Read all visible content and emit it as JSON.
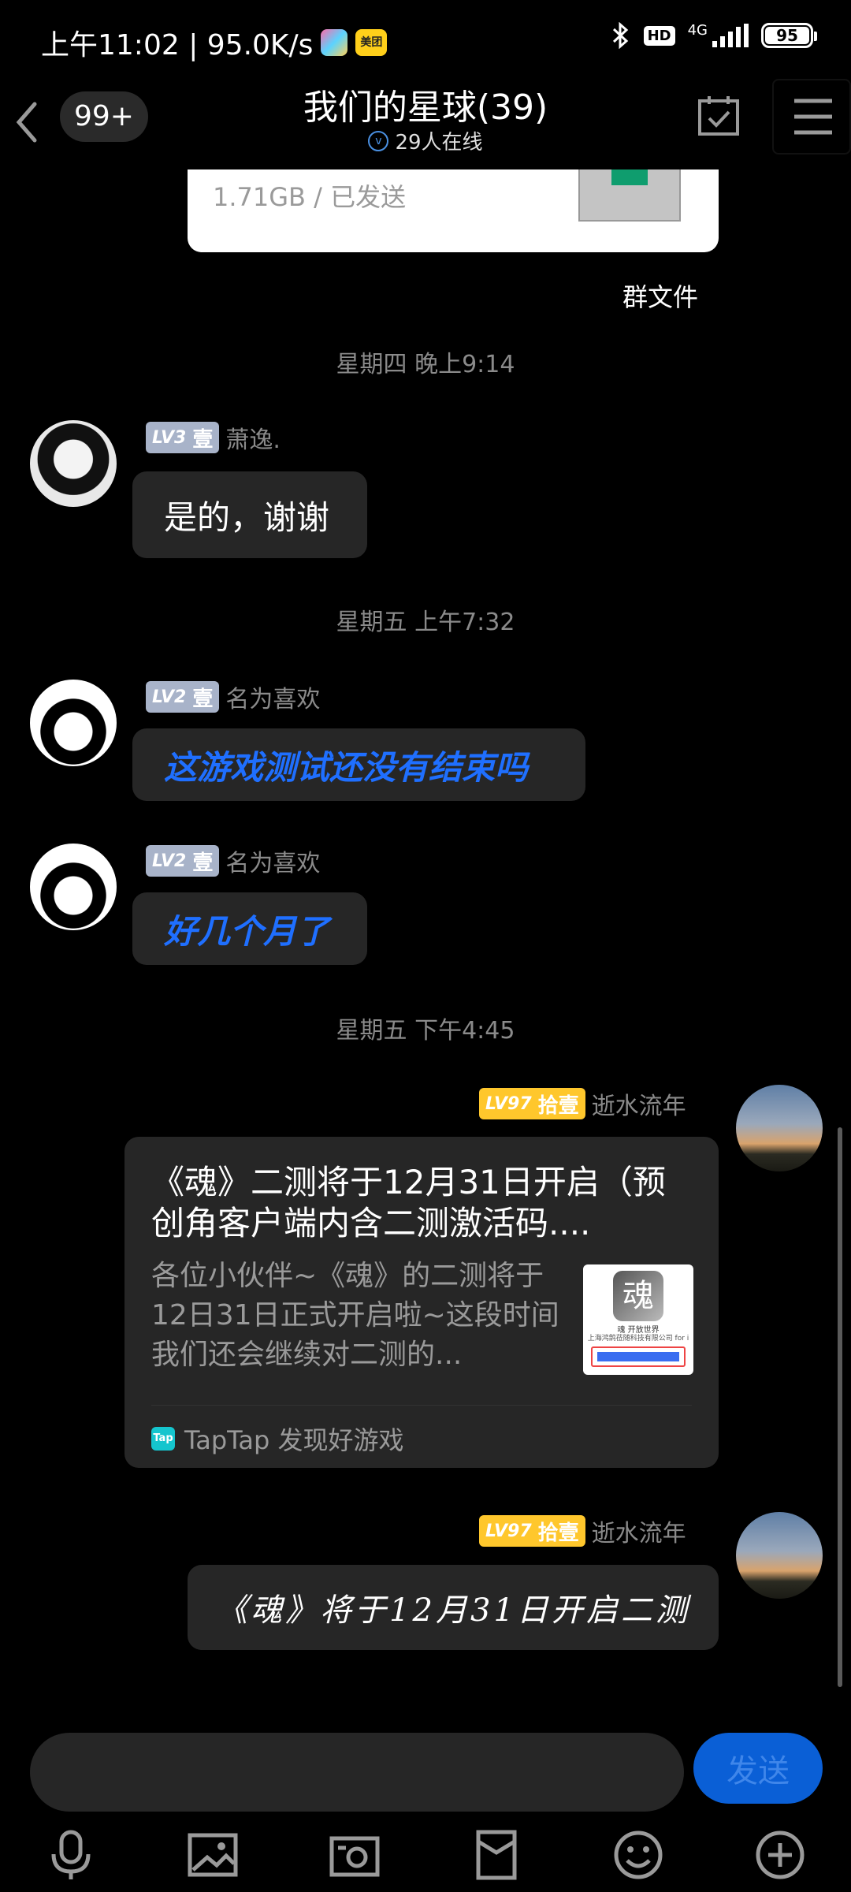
{
  "status_bar": {
    "time_speed": "上午11:02 | 95.0K/s",
    "meituan_label": "美团",
    "hd": "HD",
    "network": "4G",
    "battery": "95"
  },
  "header": {
    "unread_count": "99+",
    "title": "我们的星球(39)",
    "online": "29人在线"
  },
  "file_message": {
    "meta": "1.71GB / 已发送",
    "source": "群文件"
  },
  "timestamps": [
    "星期四 晚上9:14",
    "星期五 上午7:32",
    "星期五 下午4:45"
  ],
  "messages": [
    {
      "level": "LV3",
      "rank": "壹",
      "name": "萧逸.",
      "text": "是的，谢谢"
    },
    {
      "level": "LV2",
      "rank": "壹",
      "name": "名为喜欢",
      "text": "这游戏测试还没有结束吗"
    },
    {
      "level": "LV2",
      "rank": "壹",
      "name": "名为喜欢",
      "text": "好几个月了"
    },
    {
      "level": "LV97",
      "rank": "拾壹",
      "name": "逝水流年"
    },
    {
      "level": "LV97",
      "rank": "拾壹",
      "name": "逝水流年",
      "text": "《魂》将于12月31日开启二测"
    }
  ],
  "link_card": {
    "title": "《魂》二测将于12月31日开启（预创角客户端内含二测激活码....",
    "description": "各位小伙伴~《魂》的二测将于12日31日正式开启啦~这段时间我们还会继续对二测的...",
    "thumb_logo": "魂",
    "thumb_line1": "魂 开放世界",
    "thumb_line2": "上海鸿鹄莅随科技有限公司 for i",
    "source_icon": "Tap",
    "source": "TapTap 发现好游戏"
  },
  "input": {
    "value": "",
    "send_label": "发送"
  },
  "toolbar_icons": [
    "microphone-icon",
    "image-icon",
    "camera-icon",
    "red-packet-icon",
    "emoji-icon",
    "plus-icon"
  ],
  "colors": {
    "background": "#000000",
    "bubble": "#262626",
    "blue_text": "#1f6fff",
    "send_button": "#0a5fd6",
    "gold_badge": "#ffc72c",
    "silver_badge": "#a8b3c9"
  }
}
